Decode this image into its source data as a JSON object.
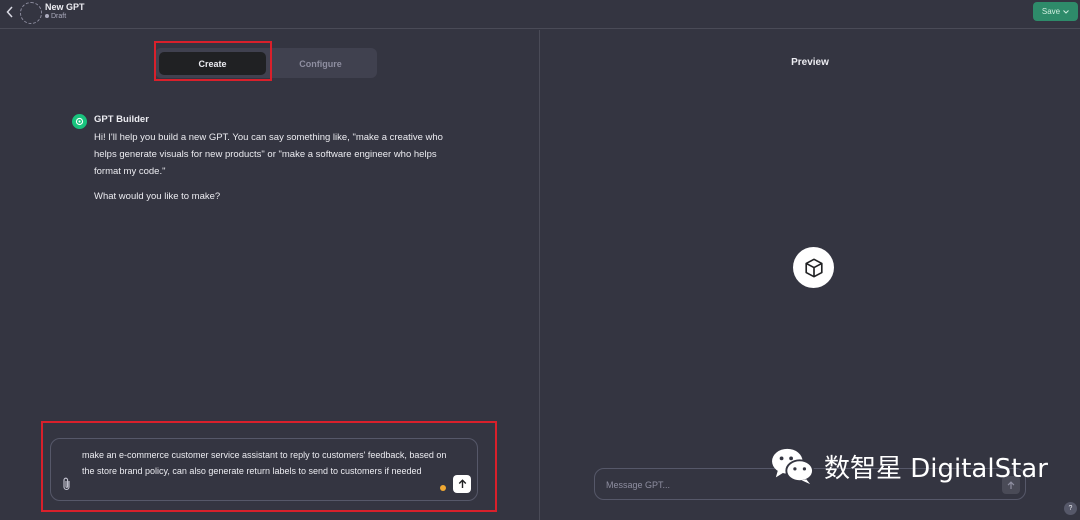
{
  "header": {
    "title": "New GPT",
    "status": "Draft",
    "save_label": "Save"
  },
  "tabs": [
    {
      "label": "Create",
      "active": true
    },
    {
      "label": "Configure",
      "active": false
    }
  ],
  "builder": {
    "name": "GPT Builder",
    "message": "Hi! I'll help you build a new GPT. You can say something like, \"make a creative who helps generate visuals for new products\" or \"make a software engineer who helps format my code.\"",
    "question": "What would you like to make?"
  },
  "composer": {
    "text": "make an e-commerce customer service assistant to reply to customers' feedback, based on the store brand policy, can also generate return labels to send to customers if needed"
  },
  "preview": {
    "title": "Preview",
    "message_placeholder": "Message GPT..."
  },
  "watermark": {
    "text": "数智星 DigitalStar"
  },
  "help": {
    "label": "?"
  },
  "colors": {
    "background": "#343541",
    "accent_green": "#2e8b6a",
    "highlight_red": "#d9202b",
    "builder_icon": "#19c37d",
    "status_dot": "#f0a832"
  }
}
